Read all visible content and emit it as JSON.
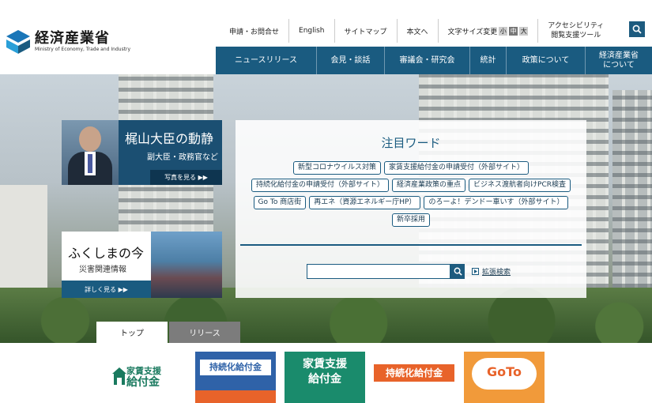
{
  "header": {
    "logo_title": "経済産業省",
    "logo_subtitle": "Ministry of Economy, Trade and Industry",
    "util_links": [
      "申請・お問合せ",
      "English",
      "サイトマップ",
      "本文へ"
    ],
    "font_size_label": "文字サイズ変更",
    "font_sizes": [
      "小",
      "中",
      "大"
    ],
    "accessibility_line1": "アクセシビリティ",
    "accessibility_line2": "閲覧支援ツール",
    "search_icon": "search-icon"
  },
  "nav": {
    "items": [
      "ニュースリリース",
      "会見・談話",
      "審議会・研究会",
      "統計",
      "政策について"
    ],
    "about_line1": "経済産業省",
    "about_line2": "について"
  },
  "hero": {
    "minister_title": "梶山大臣の動静",
    "minister_sub": "副大臣・政務官など",
    "minister_more": "写真を見る ▶▶",
    "fukushima_title": "ふくしまの今",
    "fukushima_sub": "災害関連情報",
    "fukushima_more": "詳しく見る ▶▶"
  },
  "keywords": {
    "title": "注目ワード",
    "rows": [
      [
        "新型コロナウイルス対策",
        "家賃支援給付金の申請受付（外部サイト）"
      ],
      [
        "持続化給付金の申請受付（外部サイト）",
        "経済産業政策の重点",
        "ビジネス渡航者向けPCR検査"
      ],
      [
        "Go To 商店街",
        "再エネ（資源エネルギー庁HP）",
        "のろーよ！デンドー車いす（外部サイト）"
      ],
      [
        "新卒採用"
      ]
    ],
    "search_placeholder": "",
    "advanced_search": "拡張検索"
  },
  "tabs": [
    "トップ",
    "リリース"
  ],
  "banners": {
    "b1_line1": "家賃支援",
    "b1_line2": "給付金",
    "b2_text": "持続化給付金",
    "b3_line1": "家賃支援",
    "b3_line2": "給付金",
    "b4_text": "持続化給付金",
    "b5_text": "GoTo"
  },
  "colors": {
    "brand": "#1a5b80",
    "accent_orange": "#e8632a",
    "accent_green": "#1a8b6c"
  }
}
